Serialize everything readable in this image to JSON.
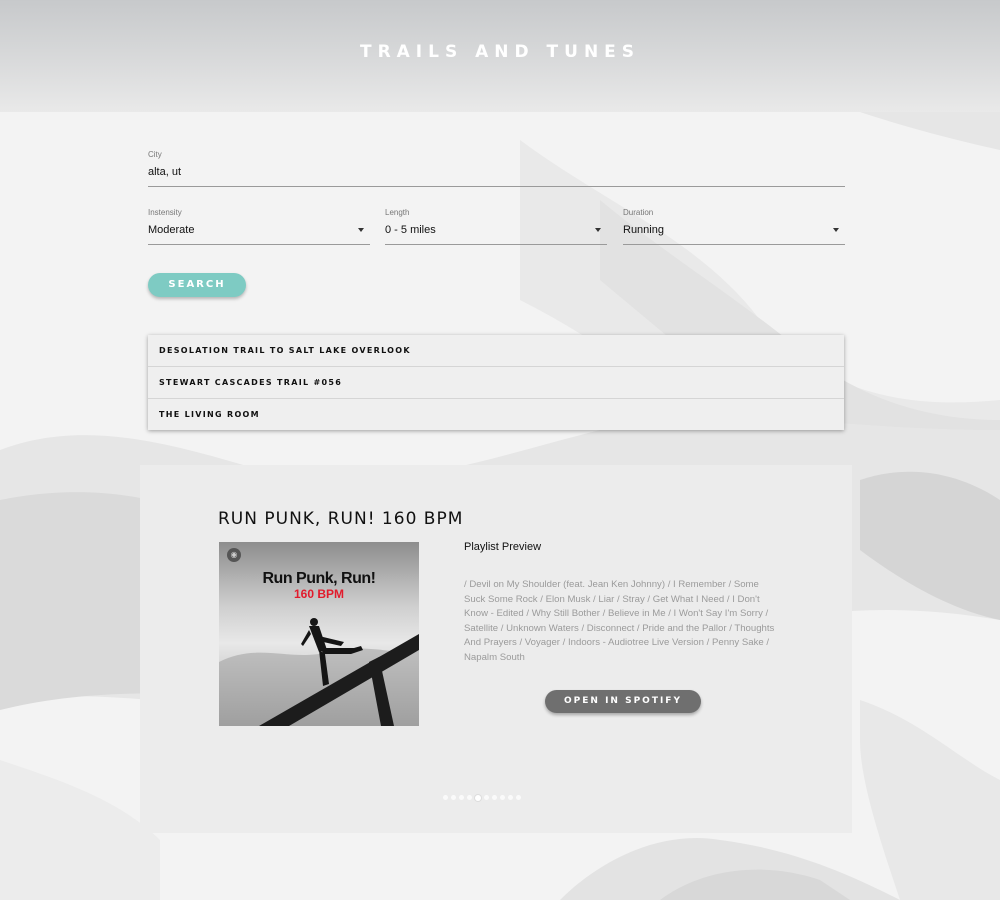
{
  "site": {
    "title": "TRAILS AND TUNES"
  },
  "form": {
    "city": {
      "label": "City",
      "value": "alta, ut"
    },
    "intensity": {
      "label": "Instensity",
      "value": "Moderate"
    },
    "length": {
      "label": "Length",
      "value": "0 - 5 miles"
    },
    "duration": {
      "label": "Duration",
      "value": "Running"
    },
    "search_label": "SEARCH"
  },
  "trails": [
    {
      "name": "DESOLATION TRAIL TO SALT LAKE OVERLOOK"
    },
    {
      "name": "STEWART CASCADES TRAIL #056"
    },
    {
      "name": "THE LIVING ROOM"
    }
  ],
  "playlist": {
    "title": "RUN PUNK, RUN! 160 BPM",
    "cover_title": "Run Punk, Run!",
    "cover_bpm": "160 BPM",
    "preview_label": "Playlist Preview",
    "tracks_text": "/ Devil on My Shoulder (feat. Jean Ken Johnny) / I Remember / Some Suck Some Rock / Elon Musk / Liar / Stray / Get What I Need / I Don't Know - Edited / Why Still Bother / Believe in Me / I Won't Say I'm Sorry / Satellite / Unknown Waters / Disconnect / Pride and the Pallor / Thoughts And Prayers / Voyager / Indoors - Audiotree Live Version / Penny Sake / Napalm South",
    "open_label": "OPEN IN SPOTIFY"
  },
  "carousel": {
    "count": 10,
    "active_index": 4
  },
  "icons": {
    "dropdown": "chevron-down-icon",
    "spotify": "spotify-icon"
  },
  "colors": {
    "accent": "#7ecbc3",
    "spotify_button": "#6f6f6f",
    "bpm": "#e21b2c"
  }
}
